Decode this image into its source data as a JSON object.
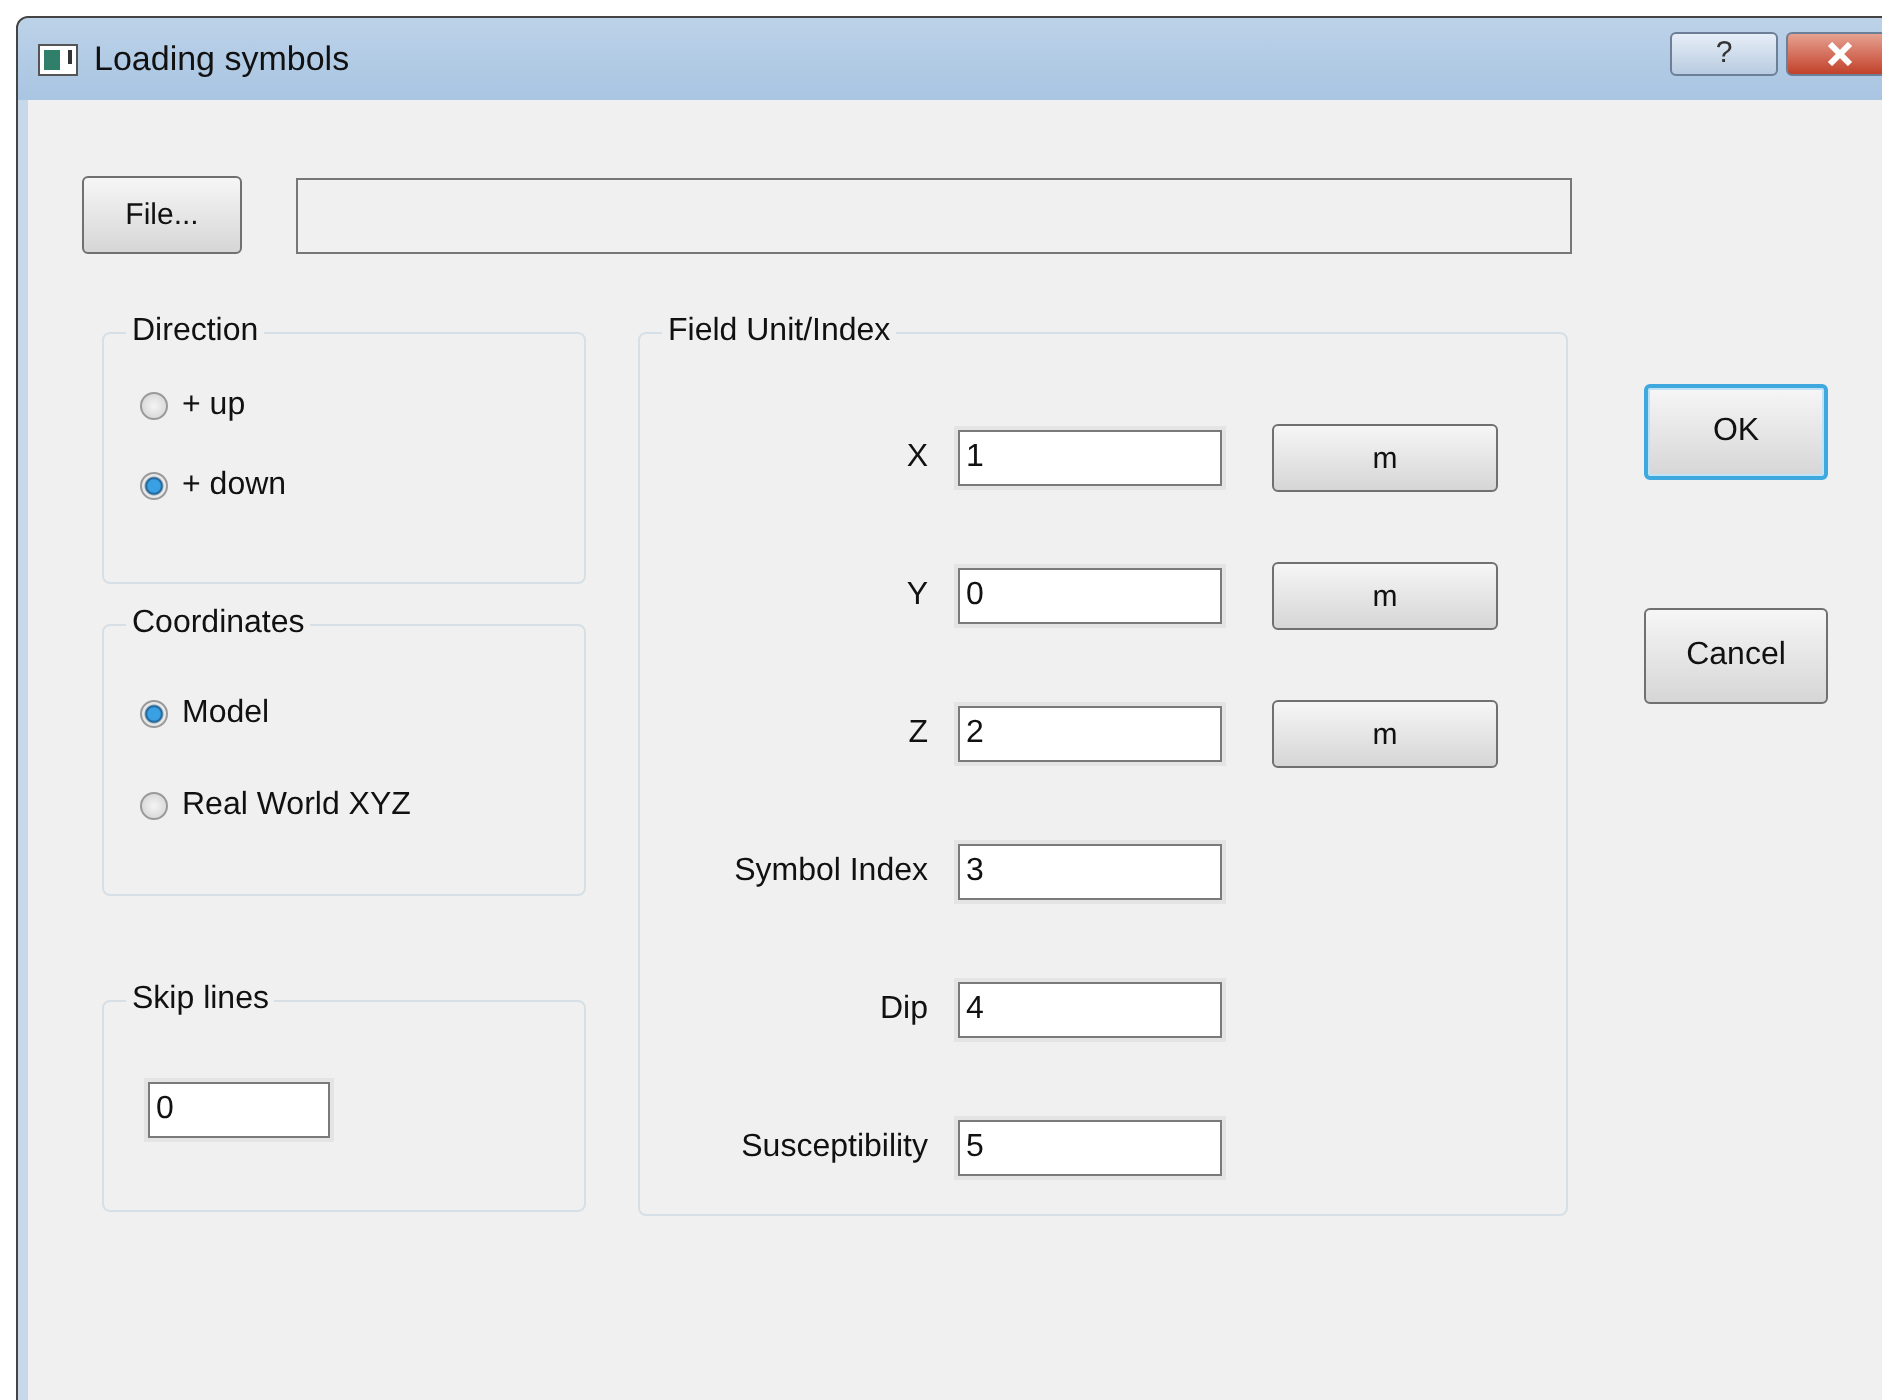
{
  "window": {
    "title": "Loading symbols",
    "help_button": "?"
  },
  "file_button": "File...",
  "direction": {
    "title": "Direction",
    "options": [
      {
        "label": "+ up",
        "selected": false
      },
      {
        "label": "+ down",
        "selected": true
      }
    ]
  },
  "coordinates": {
    "title": "Coordinates",
    "options": [
      {
        "label": "Model",
        "selected": true
      },
      {
        "label": "Real World XYZ",
        "selected": false
      }
    ]
  },
  "skip_lines": {
    "title": "Skip lines",
    "value": "0"
  },
  "field_unit_index": {
    "title": "Field Unit/Index",
    "rows": [
      {
        "label": "X",
        "value": "1",
        "unit": "m"
      },
      {
        "label": "Y",
        "value": "0",
        "unit": "m"
      },
      {
        "label": "Z",
        "value": "2",
        "unit": "m"
      },
      {
        "label": "Symbol Index",
        "value": "3"
      },
      {
        "label": "Dip",
        "value": "4"
      },
      {
        "label": "Susceptibility",
        "value": "5"
      }
    ]
  },
  "buttons": [
    {
      "label": "OK",
      "default": true
    },
    {
      "label": "Cancel",
      "default": false
    }
  ]
}
